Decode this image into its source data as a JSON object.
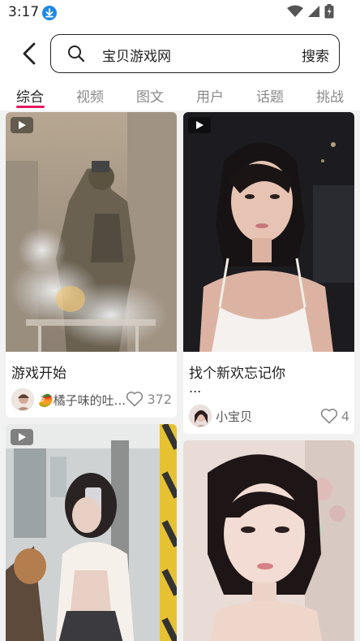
{
  "status": {
    "time": "3:17"
  },
  "search": {
    "query": "宝贝游戏网",
    "button": "搜索"
  },
  "tabs": [
    {
      "label": "综合"
    },
    {
      "label": "视频"
    },
    {
      "label": "图文"
    },
    {
      "label": "用户"
    },
    {
      "label": "话题"
    },
    {
      "label": "挑战"
    }
  ],
  "posts": [
    {
      "title": "游戏开始",
      "author": "🥭橘子味的吐...",
      "likes": "372",
      "has_play": true
    },
    {
      "title": "找个新欢忘记你",
      "title_cont": "...",
      "author": "小宝贝",
      "likes": "4",
      "has_play": true
    },
    {
      "has_play": true
    },
    {
      "has_play": false
    }
  ],
  "colors": {
    "accent": "#e31c5f",
    "download_badge": "#1e88e5"
  }
}
